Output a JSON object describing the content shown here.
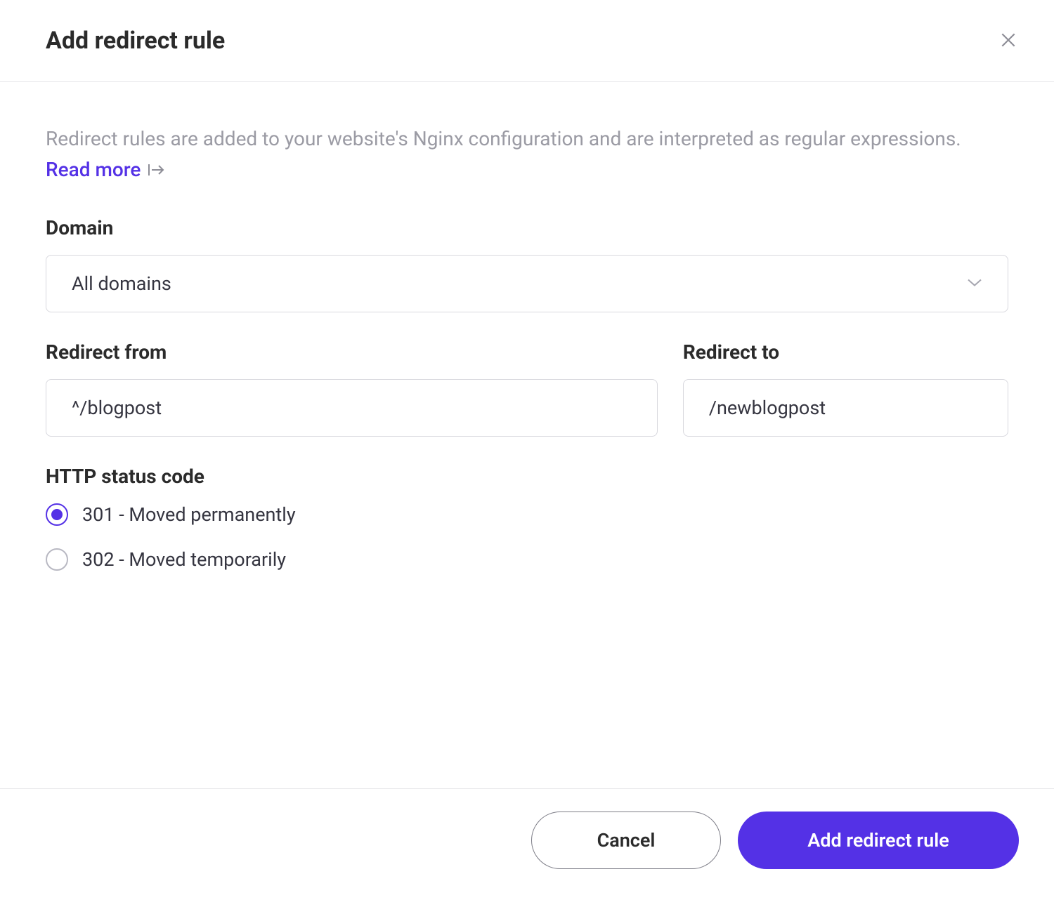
{
  "modal": {
    "title": "Add redirect rule",
    "description": "Redirect rules are added to your website's Nginx configuration and are interpreted as regular expressions.",
    "read_more_label": "Read more"
  },
  "form": {
    "domain": {
      "label": "Domain",
      "value": "All domains"
    },
    "redirect_from": {
      "label": "Redirect from",
      "value": "^/blogpost"
    },
    "redirect_to": {
      "label": "Redirect to",
      "value": "/newblogpost"
    },
    "status_code": {
      "label": "HTTP status code",
      "options": [
        {
          "label": "301 - Moved permanently",
          "selected": true
        },
        {
          "label": "302 - Moved temporarily",
          "selected": false
        }
      ]
    }
  },
  "footer": {
    "cancel_label": "Cancel",
    "submit_label": "Add redirect rule"
  },
  "colors": {
    "accent": "#5431e6",
    "text_muted": "#9b9ba4",
    "border": "#d8d8de"
  }
}
